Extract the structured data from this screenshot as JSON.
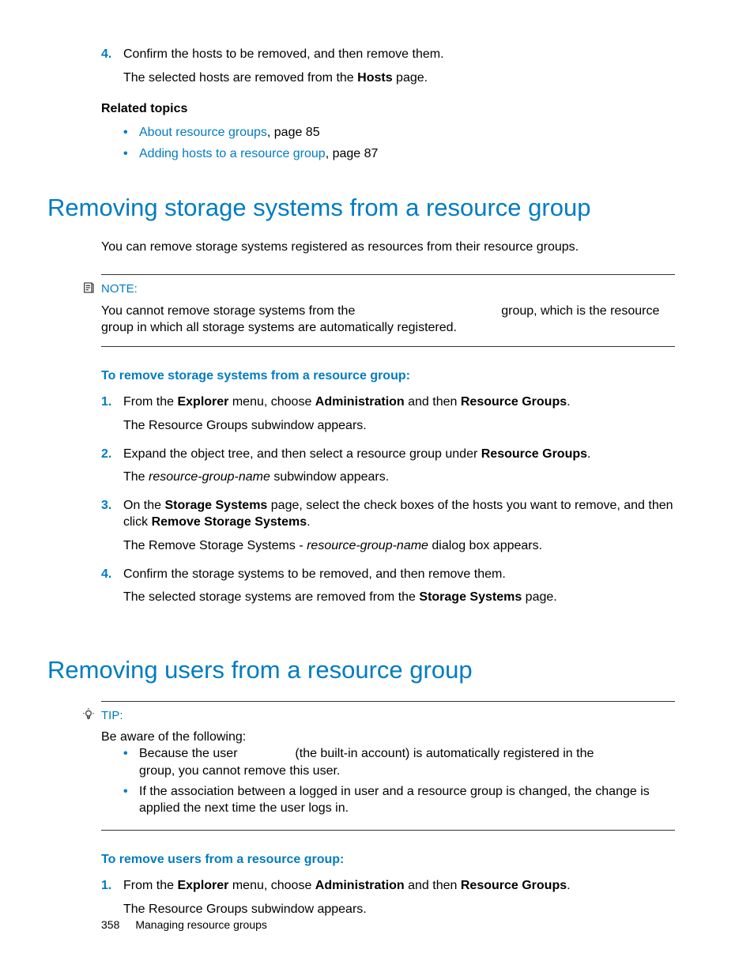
{
  "top": {
    "step4_marker": "4.",
    "step4_t1": "Confirm the hosts to be removed, and then remove them.",
    "step4_f1a": "The selected hosts are removed from the ",
    "step4_f1b": "Hosts",
    "step4_f1c": " page.",
    "related_heading": "Related topics",
    "rel1_link": "About resource groups",
    "rel1_rest": ", page 85",
    "rel2_link": "Adding hosts to a resource group",
    "rel2_rest": ", page 87"
  },
  "sec1": {
    "title": "Removing storage systems from a resource group",
    "intro": "You can remove storage systems registered as resources from their resource groups.",
    "note_label": "NOTE:",
    "note_body": "You cannot remove storage systems from the             group, which is the resource group in which all storage systems are automatically registered.",
    "task_heading": "To remove storage systems from a resource group:",
    "s1_marker": "1.",
    "s1_t1a": "From the ",
    "s1_t1b": "Explorer",
    "s1_t1c": " menu, choose ",
    "s1_t1d": "Administration",
    "s1_t1e": " and then ",
    "s1_t1f": "Resource Groups",
    "s1_t1g": ".",
    "s1_f": "The Resource Groups subwindow appears.",
    "s2_marker": "2.",
    "s2_t1a": "Expand the object tree, and then select a resource group under ",
    "s2_t1b": "Resource Groups",
    "s2_t1c": ".",
    "s2_f1a": "The ",
    "s2_f1b": "resource-group-name",
    "s2_f1c": " subwindow appears.",
    "s3_marker": "3.",
    "s3_t1a": "On the ",
    "s3_t1b": "Storage Systems",
    "s3_t1c": " page, select the check boxes of the hosts you want to remove, and then click ",
    "s3_t1d": "Remove Storage Systems",
    "s3_t1e": ".",
    "s3_f1a": "The Remove Storage Systems - ",
    "s3_f1b": "resource-group-name",
    "s3_f1c": " dialog box appears.",
    "s4_marker": "4.",
    "s4_t1": "Confirm the storage systems to be removed, and then remove them.",
    "s4_f1a": "The selected storage systems are removed from the ",
    "s4_f1b": "Storage Systems",
    "s4_f1c": " page."
  },
  "sec2": {
    "title": "Removing users from a resource group",
    "tip_label": "TIP:",
    "tip_intro": "Be aware of the following:",
    "tip_b1": "Because the user      (the built-in account) is automatically registered in the       group, you cannot remove this user.",
    "tip_b2": "If the association between a logged in user and a resource group is changed, the change is applied the next time the user logs in.",
    "task_heading": "To remove users from a resource group:",
    "s1_marker": "1.",
    "s1_t1a": "From the ",
    "s1_t1b": "Explorer",
    "s1_t1c": " menu, choose ",
    "s1_t1d": "Administration",
    "s1_t1e": " and then ",
    "s1_t1f": "Resource Groups",
    "s1_t1g": ".",
    "s1_f": "The Resource Groups subwindow appears."
  },
  "footer": {
    "page": "358",
    "chapter": "Managing resource groups"
  }
}
